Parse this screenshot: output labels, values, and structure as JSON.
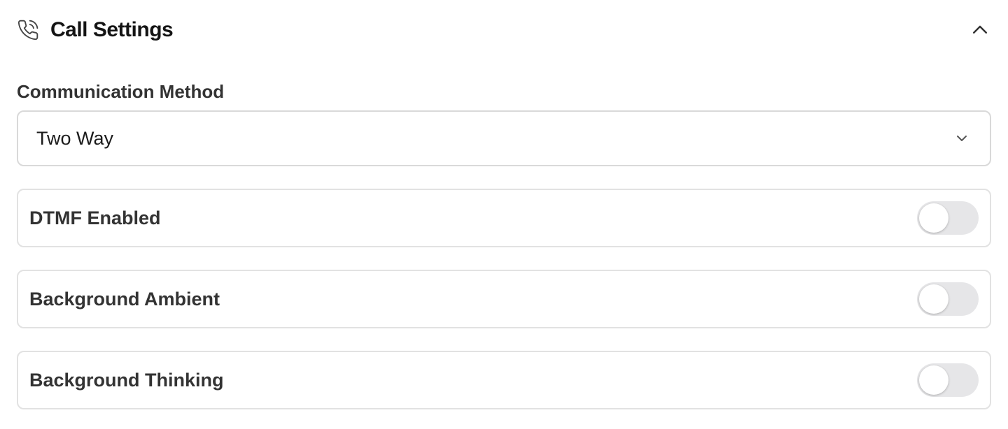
{
  "section": {
    "title": "Call Settings",
    "icon": "phone-icon",
    "collapse_icon": "chevron-up-icon",
    "expanded": true
  },
  "communication_method": {
    "label": "Communication Method",
    "selected": "Two Way",
    "icon": "chevron-down-icon"
  },
  "toggles": [
    {
      "label": "DTMF Enabled",
      "enabled": false
    },
    {
      "label": "Background Ambient",
      "enabled": false
    },
    {
      "label": "Background Thinking",
      "enabled": false
    }
  ],
  "colors": {
    "switch_off_track": "#e6e6e8",
    "border": "#d9d9d9",
    "text": "#333333"
  }
}
